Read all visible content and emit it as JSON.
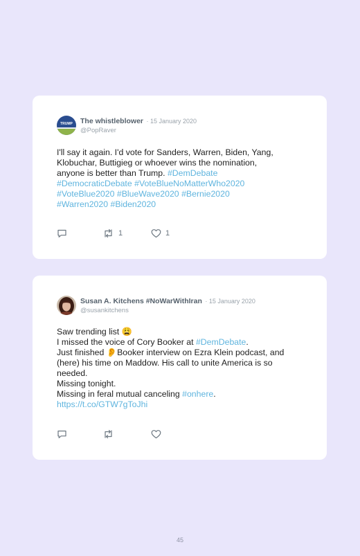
{
  "tweets": [
    {
      "name": "The whistleblower",
      "date": "· 15 January 2020",
      "handle": "@PopRaver",
      "avatar_text": "TRUMP",
      "lines": [
        [
          {
            "t": "I'll say it again. I'd vote for Sanders, Warren, Biden, Yang,"
          }
        ],
        [
          {
            "t": "Klobuchar, Buttigieg or whoever wins the nomination,"
          }
        ],
        [
          {
            "t": "anyone is better than Trump. "
          },
          {
            "t": "#DemDebate",
            "tag": true
          }
        ],
        [
          {
            "t": "#DemocraticDebate",
            "tag": true
          },
          {
            "t": " "
          },
          {
            "t": "#VoteBlueNoMatterWho2020",
            "tag": true
          }
        ],
        [
          {
            "t": "#VoteBlue2020",
            "tag": true
          },
          {
            "t": " "
          },
          {
            "t": "#BlueWave2020",
            "tag": true
          },
          {
            "t": " "
          },
          {
            "t": "#Bernie2020",
            "tag": true
          }
        ],
        [
          {
            "t": "#Warren2020",
            "tag": true
          },
          {
            "t": " "
          },
          {
            "t": "#Biden2020",
            "tag": true
          }
        ]
      ],
      "retweets": "1",
      "likes": "1"
    },
    {
      "name": "Susan A. Kitchens #NoWarWithIran",
      "date": "· 15 January 2020",
      "handle": "@susankitchens",
      "lines": [
        [
          {
            "t": "Saw trending list 😩"
          }
        ],
        [
          {
            "t": "I missed the voice of Cory Booker at "
          },
          {
            "t": "#DemDebate",
            "tag": true
          },
          {
            "t": "."
          }
        ],
        [
          {
            "t": "Just finished 👂Booker interview on Ezra Klein podcast, and"
          }
        ],
        [
          {
            "t": "(here) his time on Maddow. His call to unite America is so"
          }
        ],
        [
          {
            "t": "needed."
          }
        ],
        [
          {
            "t": "Missing tonight."
          }
        ],
        [
          {
            "t": "Missing in feral mutual canceling "
          },
          {
            "t": "#onhere",
            "tag": true
          },
          {
            "t": "."
          }
        ],
        [
          {
            "t": "https://t.co/GTW7gToJhi",
            "tag": true
          }
        ]
      ],
      "retweets": "",
      "likes": ""
    }
  ],
  "page_number": "45",
  "colors": {
    "background": "#e9e6fb",
    "card": "#ffffff",
    "hashtag": "#5fb4de",
    "name": "#55616c",
    "meta": "#9aa3ab"
  },
  "icons": {
    "reply": "reply-icon",
    "retweet": "retweet-icon",
    "like": "heart-icon"
  }
}
